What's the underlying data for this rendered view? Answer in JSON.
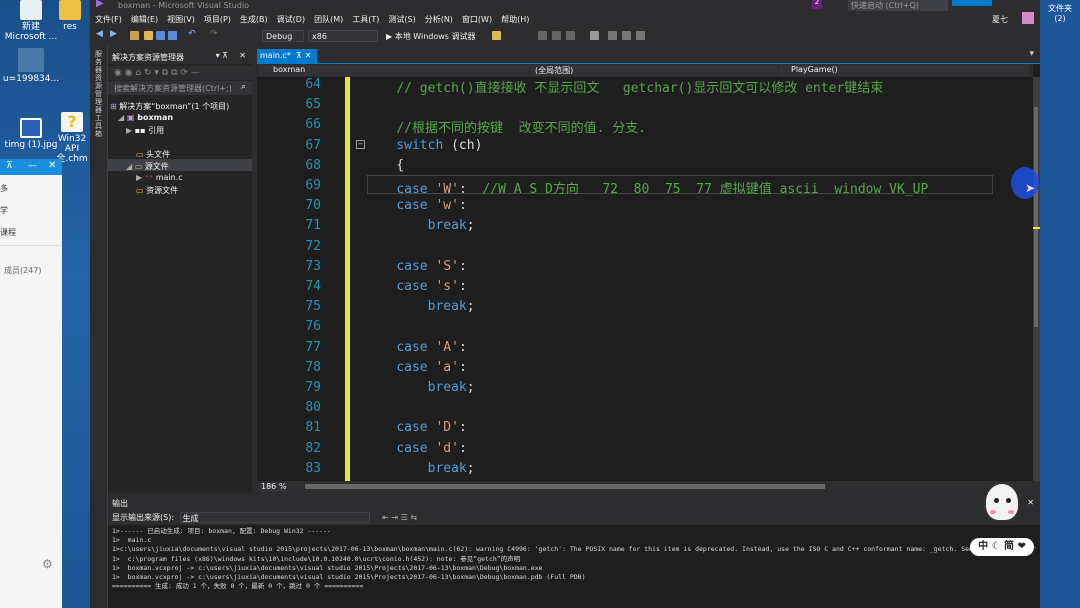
{
  "window": {
    "title": "boxman - Microsoft Visual Studio",
    "quick_launch": "快速启动 (Ctrl+Q)",
    "user": "夏七",
    "badge": "2"
  },
  "desktop": {
    "icons": [
      {
        "label": "新建\nMicrosoft ..."
      },
      {
        "label": "res"
      },
      {
        "label": "u=199834..."
      },
      {
        "label": "timg (1).jpg"
      },
      {
        "label": "Win32 API 全.chm"
      }
    ],
    "right_icon": {
      "label": "文件夹\n(2)"
    }
  },
  "qq": {
    "items": [
      "多",
      "学",
      "课程"
    ],
    "members": "成员(247)"
  },
  "menu": [
    "文件(F)",
    "编辑(E)",
    "视图(V)",
    "项目(P)",
    "生成(B)",
    "调试(D)",
    "团队(M)",
    "工具(T)",
    "测试(S)",
    "分析(N)",
    "窗口(W)",
    "帮助(H)"
  ],
  "toolbar": {
    "config": "Debug",
    "platform": "x86",
    "run_label": "▶ 本地 Windows 调试器"
  },
  "side_tabs": "服务器资源管理器 工具箱",
  "solution": {
    "title": "解决方案资源管理器",
    "search_placeholder": "搜索解决方案资源管理器(Ctrl+;)",
    "root": "解决方案“boxman”(1 个项目)",
    "project": "boxman",
    "refs": "引用",
    "headers": "头文件",
    "sources": "源文件",
    "main_file": "main.c",
    "resources": "资源文件"
  },
  "editor": {
    "tab": "main.c*",
    "nav_file": "boxman",
    "nav_scope": "(全局范围)",
    "nav_func": "PlayGame()",
    "zoom": "186 %",
    "lines": [
      {
        "n": "64",
        "t": "    // getch()直接接收 不显示回文   getchar()显示回文可以修改 enter键结束"
      },
      {
        "n": "65",
        "t": ""
      },
      {
        "n": "66",
        "t": "    //根据不同的按键  改变不同的值. 分支."
      },
      {
        "n": "67",
        "t": "    switch (ch)"
      },
      {
        "n": "68",
        "t": "    {"
      },
      {
        "n": "69",
        "t": "    case 'W':  //W A S D方向   72  80  75  77 虚拟键值 ascii  window VK_UP"
      },
      {
        "n": "70",
        "t": "    case 'w':"
      },
      {
        "n": "71",
        "t": "        break;"
      },
      {
        "n": "72",
        "t": ""
      },
      {
        "n": "73",
        "t": "    case 'S':"
      },
      {
        "n": "74",
        "t": "    case 's':"
      },
      {
        "n": "75",
        "t": "        break;"
      },
      {
        "n": "76",
        "t": ""
      },
      {
        "n": "77",
        "t": "    case 'A':"
      },
      {
        "n": "78",
        "t": "    case 'a':"
      },
      {
        "n": "79",
        "t": "        break;"
      },
      {
        "n": "80",
        "t": ""
      },
      {
        "n": "81",
        "t": "    case 'D':"
      },
      {
        "n": "82",
        "t": "    case 'd':"
      },
      {
        "n": "83",
        "t": "        break;"
      }
    ]
  },
  "output": {
    "title": "输出",
    "source_label": "显示输出来源(S):",
    "source_value": "生成",
    "lines": [
      "1>------ 已启动生成: 项目: boxman, 配置: Debug Win32 ------",
      "1>  main.c",
      "1>c:\\users\\jiuxia\\documents\\visual studio 2015\\projects\\2017-06-13\\boxman\\boxman\\main.c(62): warning C4996: 'getch': The POSIX name for this item is deprecated. Instead, use the ISO C and C++ conformant name: _getch. See online help for",
      "1>  c:\\program files (x86)\\windows kits\\10\\include\\10.0.10240.0\\ucrt\\conio.h(452): note: 参见“getch”的声明",
      "1>  boxman.vcxproj -> c:\\users\\jiuxia\\documents\\visual studio 2015\\Projects\\2017-06-13\\boxman\\Debug\\boxman.exe",
      "1>  boxman.vcxproj -> c:\\users\\jiuxia\\documents\\visual studio 2015\\Projects\\2017-06-13\\boxman\\Debug\\boxman.pdb (Full PDB)",
      "========== 生成: 成功 1 个，失败 0 个，最新 0 个，跳过 0 个 =========="
    ]
  },
  "mascot": {
    "label": "中 ☾ 简 ❤"
  }
}
